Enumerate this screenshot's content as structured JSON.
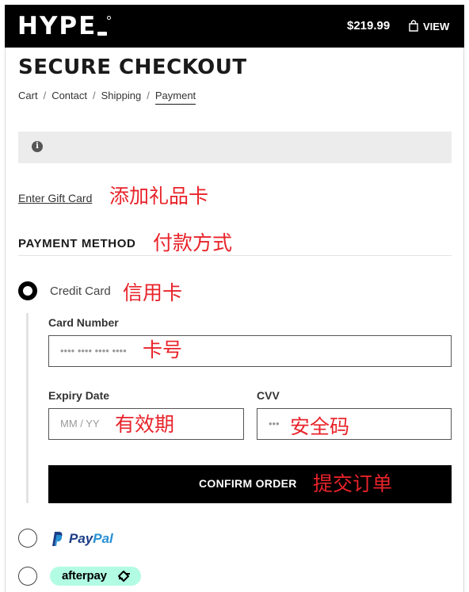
{
  "header": {
    "logo_text": "HYPE",
    "total": "$219.99",
    "view_label": "VIEW"
  },
  "page": {
    "title": "SECURE CHECKOUT"
  },
  "breadcrumb": {
    "items": [
      "Cart",
      "Contact",
      "Shipping",
      "Payment"
    ],
    "separator": "/"
  },
  "notice": {
    "icon": "info-icon"
  },
  "gift_card": {
    "link_label": "Enter Gift Card"
  },
  "payment": {
    "heading": "PAYMENT METHOD",
    "credit_card": {
      "label": "Credit Card",
      "selected": true,
      "card_number_label": "Card Number",
      "card_number_placeholder": "•••• •••• •••• ••••",
      "expiry_label": "Expiry Date",
      "expiry_placeholder": "MM / YY",
      "cvv_label": "CVV",
      "cvv_placeholder": "•••",
      "confirm_label": "CONFIRM ORDER"
    },
    "paypal": {
      "logo_pay": "Pay",
      "logo_pal": "Pal",
      "selected": false
    },
    "afterpay": {
      "logo_text": "afterpay",
      "selected": false
    }
  },
  "annotations": {
    "gift_card": "添加礼品卡",
    "payment_method": "付款方式",
    "credit_card": "信用卡",
    "card_number": "卡号",
    "expiry": "有效期",
    "cvv": "安全码",
    "confirm": "提交订单"
  },
  "colors": {
    "header_bg": "#000000",
    "annotation": "#e8232a",
    "notice_bg": "#ececec",
    "paypal_dark": "#1c3d87",
    "paypal_light": "#2790d4",
    "afterpay_mint": "#b2fce4"
  }
}
